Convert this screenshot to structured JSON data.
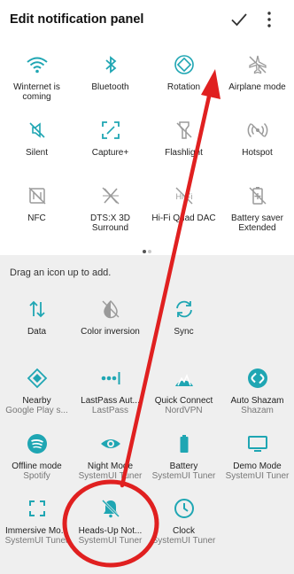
{
  "header": {
    "title": "Edit notification panel",
    "confirm_icon": "check-icon",
    "menu_icon": "more-vertical-icon"
  },
  "colors": {
    "accent": "#1fa6b3",
    "disabled": "#9a9a9a",
    "annotation_red": "#e02020"
  },
  "active_tiles": [
    {
      "label": "Winternet is coming",
      "icon": "wifi-icon"
    },
    {
      "label": "Bluetooth",
      "icon": "bluetooth-icon"
    },
    {
      "label": "Rotation",
      "icon": "rotation-icon"
    },
    {
      "label": "Airplane mode",
      "icon": "airplane-icon"
    },
    {
      "label": "Silent",
      "icon": "silent-icon"
    },
    {
      "label": "Capture+",
      "icon": "capture-icon"
    },
    {
      "label": "Flashlight",
      "icon": "flashlight-icon"
    },
    {
      "label": "Hotspot",
      "icon": "hotspot-icon"
    },
    {
      "label": "NFC",
      "icon": "nfc-icon"
    },
    {
      "label": "DTS:X 3D Surround",
      "icon": "dts-icon"
    },
    {
      "label": "Hi-Fi Quad DAC",
      "icon": "hifi-icon"
    },
    {
      "label": "Battery saver Extended",
      "icon": "battery-saver-icon"
    }
  ],
  "hint": "Drag an icon up to add.",
  "available_tiles": [
    {
      "label": "Data",
      "sub": "",
      "icon": "data-icon"
    },
    {
      "label": "Color inversion",
      "sub": "",
      "icon": "color-inversion-icon"
    },
    {
      "label": "Sync",
      "sub": "",
      "icon": "sync-icon"
    },
    {
      "label": "Nearby",
      "sub": "Google Play s...",
      "icon": "nearby-icon"
    },
    {
      "label": "LastPass Aut...",
      "sub": "LastPass",
      "icon": "lastpass-icon"
    },
    {
      "label": "Quick Connect",
      "sub": "NordVPN",
      "icon": "nordvpn-icon"
    },
    {
      "label": "Auto Shazam",
      "sub": "Shazam",
      "icon": "shazam-icon"
    },
    {
      "label": "Offline mode",
      "sub": "Spotify",
      "icon": "spotify-icon"
    },
    {
      "label": "Night Mode",
      "sub": "SystemUI Tuner",
      "icon": "eye-icon"
    },
    {
      "label": "Battery",
      "sub": "SystemUI Tuner",
      "icon": "battery-icon"
    },
    {
      "label": "Demo Mode",
      "sub": "SystemUI Tuner",
      "icon": "demo-mode-icon"
    },
    {
      "label": "Immersive Mo...",
      "sub": "SystemUI Tuner",
      "icon": "immersive-icon"
    },
    {
      "label": "Heads-Up Not...",
      "sub": "SystemUI Tuner",
      "icon": "heads-up-icon"
    },
    {
      "label": "Clock",
      "sub": "SystemUI Tuner",
      "icon": "clock-icon"
    }
  ]
}
